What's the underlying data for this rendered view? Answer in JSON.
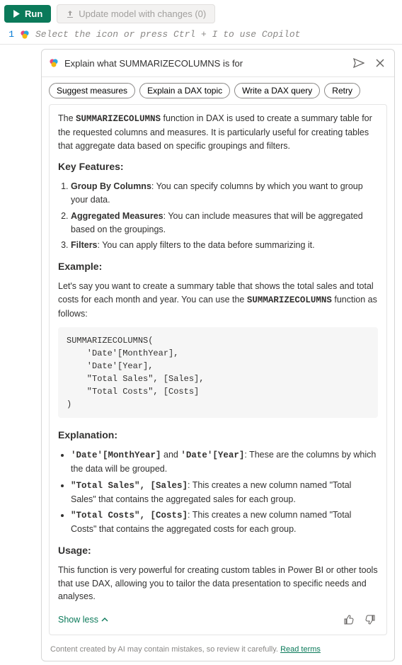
{
  "toolbar": {
    "run_label": "Run",
    "update_label": "Update model with changes (0)"
  },
  "editor": {
    "line_number": "1",
    "placeholder": "Select the icon or press Ctrl + I to use Copilot"
  },
  "panel": {
    "title": "Explain what SUMMARIZECOLUMNS is for"
  },
  "chips": {
    "suggest": "Suggest measures",
    "explain": "Explain a DAX topic",
    "write": "Write a DAX query",
    "retry": "Retry"
  },
  "body": {
    "intro_pre": "The ",
    "intro_fn": "SUMMARIZECOLUMNS",
    "intro_post": " function in DAX is used to create a summary table for the requested columns and measures. It is particularly useful for creating tables that aggregate data based on specific groupings and filters.",
    "h_keyfeatures": "Key Features:",
    "kf1_b": "Group By Columns",
    "kf1_t": ": You can specify columns by which you want to group your data.",
    "kf2_b": "Aggregated Measures",
    "kf2_t": ": You can include measures that will be aggregated based on the groupings.",
    "kf3_b": "Filters",
    "kf3_t": ": You can apply filters to the data before summarizing it.",
    "h_example": "Example:",
    "example_text_pre": "Let's say you want to create a summary table that shows the total sales and total costs for each month and year. You can use the ",
    "example_fn": "SUMMARIZECOLUMNS",
    "example_text_post": " function as follows:",
    "code": "SUMMARIZECOLUMNS(\n    'Date'[MonthYear],\n    'Date'[Year],\n    \"Total Sales\", [Sales],\n    \"Total Costs\", [Costs]\n)",
    "h_explanation": "Explanation:",
    "ex1_c1": "'Date'[MonthYear]",
    "ex1_and": " and ",
    "ex1_c2": "'Date'[Year]",
    "ex1_t": ": These are the columns by which the data will be grouped.",
    "ex2_c": "\"Total Sales\", [Sales]",
    "ex2_t": ": This creates a new column named \"Total Sales\" that contains the aggregated sales for each group.",
    "ex3_c": "\"Total Costs\", [Costs]",
    "ex3_t": ": This creates a new column named \"Total Costs\" that contains the aggregated costs for each group.",
    "h_usage": "Usage:",
    "usage_text": "This function is very powerful for creating custom tables in Power BI or other tools that use DAX, allowing you to tailor the data presentation to specific needs and analyses.",
    "show_less": "Show less"
  },
  "disclaimer": {
    "text": "Content created by AI may contain mistakes, so review it carefully. ",
    "link": "Read terms"
  }
}
